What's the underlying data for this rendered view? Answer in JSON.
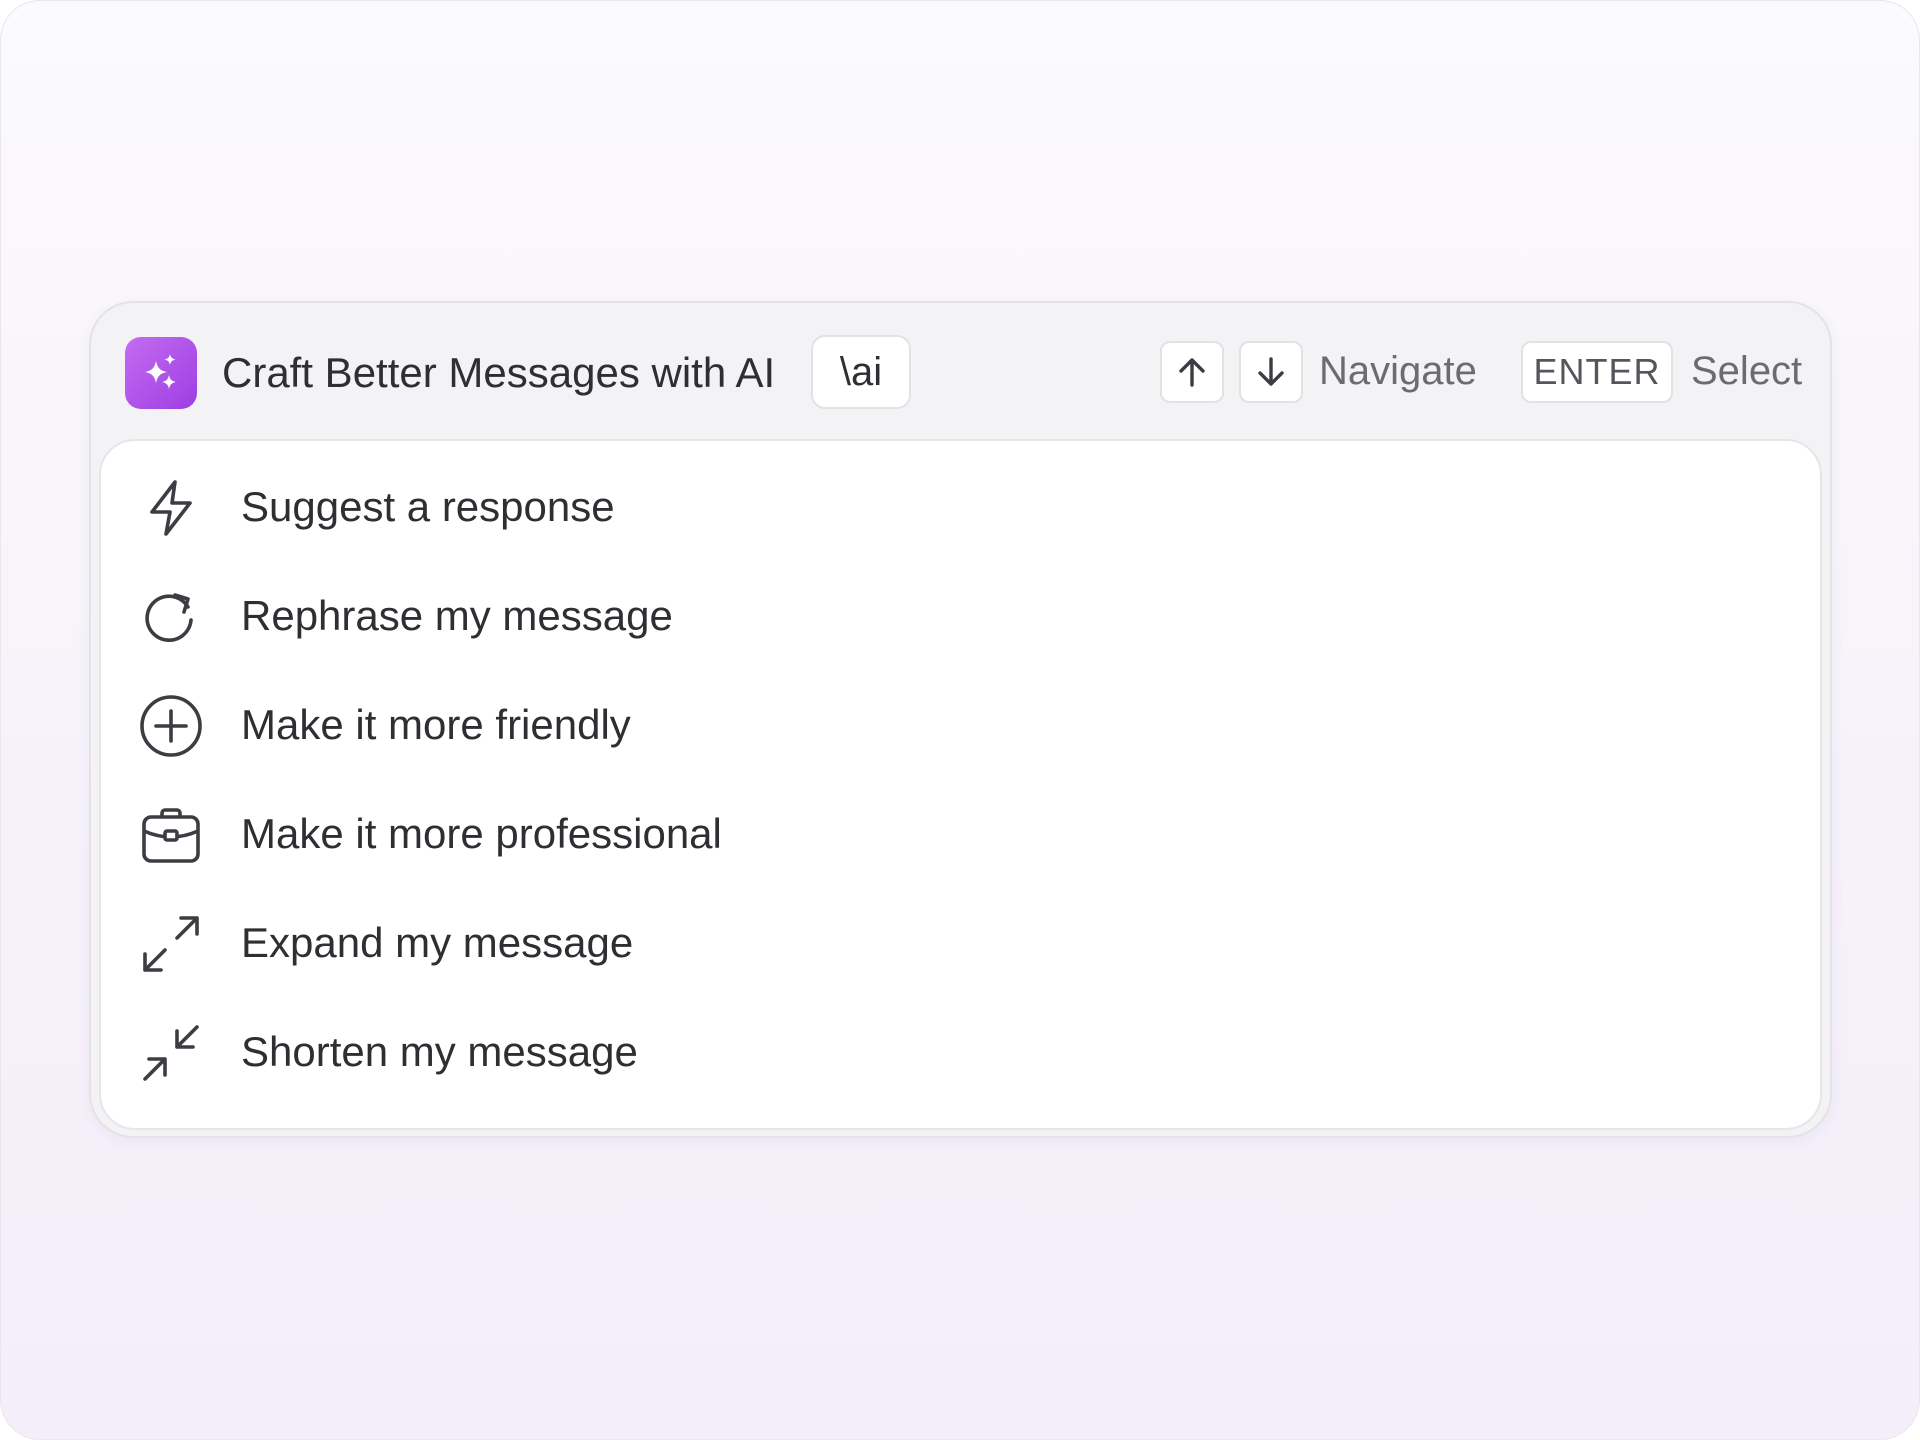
{
  "header": {
    "title": "Craft Better Messages with AI",
    "shortcut": "\\ai",
    "app_icon": "sparkles-icon",
    "accent_color": "#a54be6",
    "nav_up_icon": "arrow-up-icon",
    "nav_down_icon": "arrow-down-icon",
    "navigate_label": "Navigate",
    "enter_key": "ENTER",
    "select_label": "Select"
  },
  "menu": {
    "items": [
      {
        "label": "Suggest a response",
        "icon": "lightning-icon"
      },
      {
        "label": "Rephrase my message",
        "icon": "refresh-icon"
      },
      {
        "label": "Make it more friendly",
        "icon": "plus-circle-icon"
      },
      {
        "label": "Make it more professional",
        "icon": "briefcase-icon"
      },
      {
        "label": "Expand my message",
        "icon": "expand-icon"
      },
      {
        "label": "Shorten my message",
        "icon": "shrink-icon"
      }
    ]
  }
}
